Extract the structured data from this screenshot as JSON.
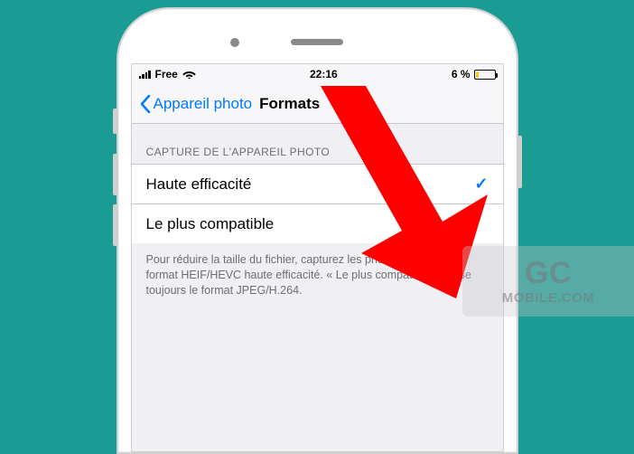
{
  "status": {
    "carrier": "Free",
    "time": "22:16",
    "battery_text": "6 %"
  },
  "nav": {
    "back_label": "Appareil photo",
    "title": "Formats"
  },
  "section": {
    "header": "CAPTURE DE L'APPAREIL PHOTO",
    "options": [
      {
        "label": "Haute efficacité",
        "selected": true
      },
      {
        "label": "Le plus compatible",
        "selected": false
      }
    ],
    "footer": "Pour réduire la taille du fichier, capturez les photos et vidéos au format HEIF/HEVC haute efficacité. « Le plus compatible » utilise toujours le format JPEG/H.264."
  },
  "watermark": {
    "line1": "GC",
    "line2": "MOBILE.COM"
  }
}
